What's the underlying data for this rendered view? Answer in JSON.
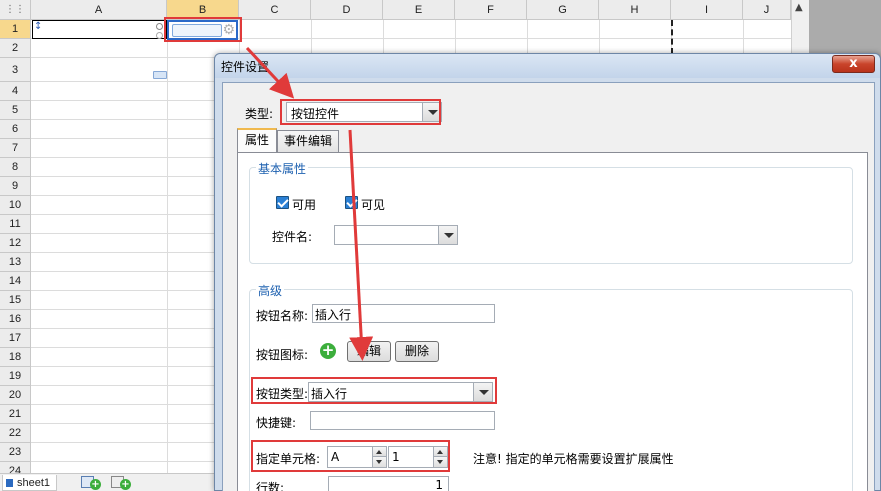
{
  "spreadsheet": {
    "corner_icon": "grid-icon",
    "columns": [
      "A",
      "B",
      "C",
      "D",
      "E",
      "F",
      "G",
      "H",
      "I",
      "J"
    ],
    "selected_column": "B",
    "rows": [
      "1",
      "2",
      "3",
      "4",
      "5",
      "6",
      "7",
      "8",
      "9",
      "10",
      "11",
      "12",
      "13",
      "14",
      "15",
      "16",
      "17",
      "18",
      "19",
      "20",
      "21",
      "22",
      "23",
      "24"
    ],
    "selected_row": "1",
    "sheet_tab": "sheet1",
    "scroll_up_icon": "chevron-up-icon"
  },
  "dialog": {
    "title": "控件设置",
    "close_label": "x",
    "type_label": "类型:",
    "type_value": "按钮控件",
    "tabs": [
      {
        "label": "属性",
        "active": true
      },
      {
        "label": "事件编辑",
        "active": false
      }
    ],
    "basic": {
      "title": "基本属性",
      "enabled_label": "可用",
      "enabled_checked": true,
      "visible_label": "可见",
      "visible_checked": true,
      "widget_name_label": "控件名:",
      "widget_name_value": ""
    },
    "advanced": {
      "title": "高级",
      "button_name_label": "按钮名称:",
      "button_name_value": "插入行",
      "button_icon_label": "按钮图标:",
      "edit_label": "编辑",
      "delete_label": "删除",
      "button_type_label": "按钮类型:",
      "button_type_value": "插入行",
      "shortcut_label": "快捷键:",
      "shortcut_value": "",
      "cell_label": "指定单元格:",
      "cell_col_value": "A",
      "cell_row_value": "1",
      "note": "注意! 指定的单元格需要设置扩展属性",
      "row_count_label": "行数:",
      "row_count_value": "1"
    }
  },
  "colors": {
    "highlight_red": "#e03a3a",
    "selection_blue": "#2a69c8",
    "header_selected": "#f7d88d",
    "group_title": "#1e61b0"
  }
}
